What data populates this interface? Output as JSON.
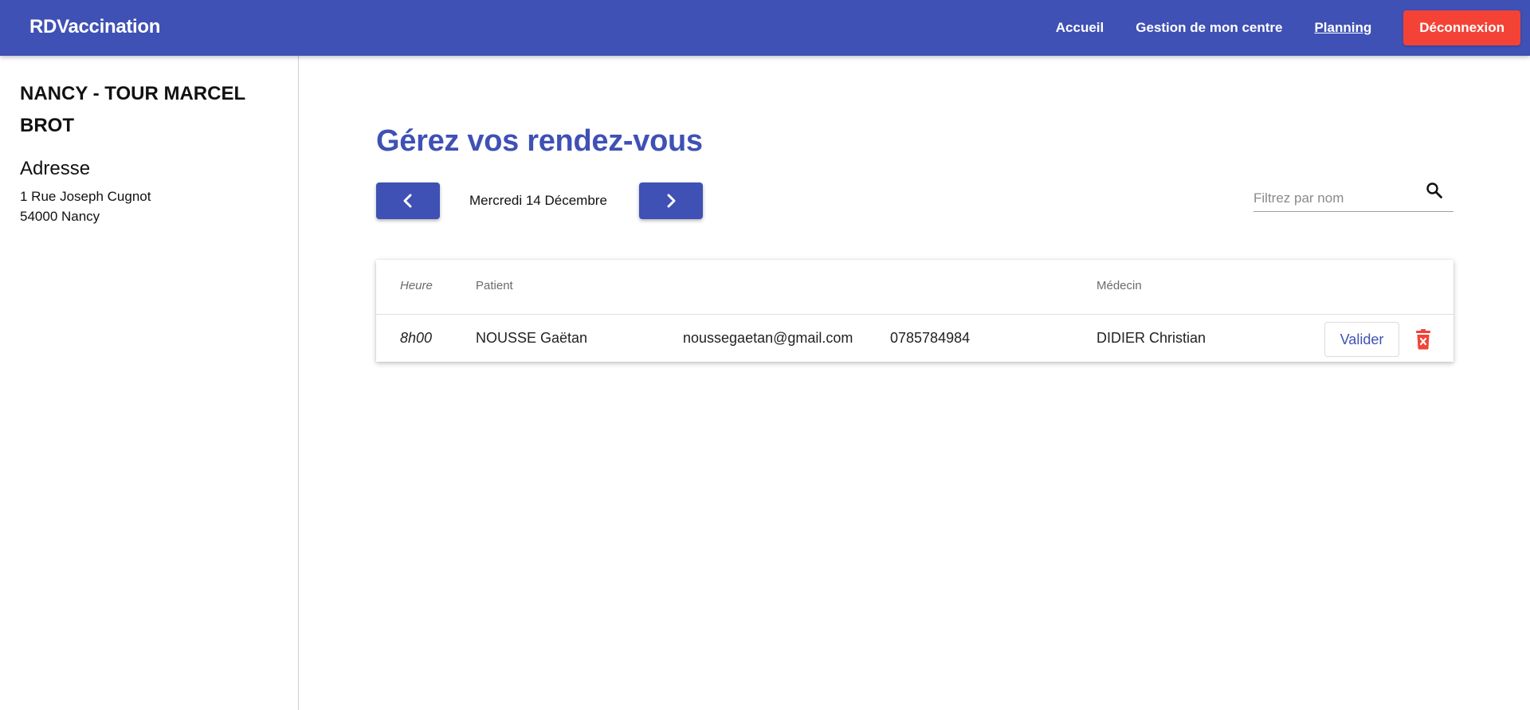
{
  "header": {
    "brand": "RDVaccination",
    "nav": [
      {
        "label": "Accueil",
        "active": false
      },
      {
        "label": "Gestion de mon centre",
        "active": false
      },
      {
        "label": "Planning",
        "active": true
      }
    ],
    "logout_label": "Déconnexion"
  },
  "sidebar": {
    "center_name": "NANCY - TOUR MARCEL BROT",
    "address_title": "Adresse",
    "address_line1": "1 Rue Joseph Cugnot",
    "address_line2": "54000 Nancy"
  },
  "main": {
    "title": "Gérez vos rendez-vous",
    "date_label": "Mercredi 14 Décembre",
    "prev_icon": "chevron-left-icon",
    "next_icon": "chevron-right-icon",
    "search": {
      "placeholder": "Filtrez par nom",
      "value": "",
      "icon": "search-icon"
    },
    "table": {
      "headers": {
        "heure": "Heure",
        "patient": "Patient",
        "medecin": "Médecin"
      },
      "rows": [
        {
          "heure": "8h00",
          "patient": "NOUSSE Gaëtan",
          "email": "noussegaetan@gmail.com",
          "telephone": "0785784984",
          "medecin": "DIDIER Christian",
          "validate_label": "Valider",
          "delete_icon": "trash-icon"
        }
      ]
    }
  },
  "colors": {
    "primary": "#3f51b5",
    "danger": "#f44336"
  }
}
